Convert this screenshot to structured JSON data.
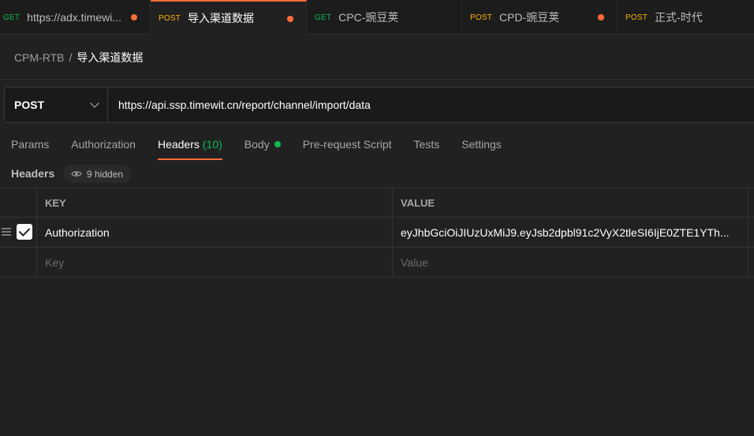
{
  "tabs": [
    {
      "method": "GET",
      "title": "https://adx.timewi..."
    },
    {
      "method": "POST",
      "title": "导入渠道数据"
    },
    {
      "method": "GET",
      "title": "CPC-豌豆荚"
    },
    {
      "method": "POST",
      "title": "CPD-豌豆荚"
    },
    {
      "method": "POST",
      "title": "正式-时代"
    }
  ],
  "breadcrumb": {
    "parent": "CPM-RTB",
    "separator": "/",
    "current": "导入渠道数据"
  },
  "request": {
    "method": "POST",
    "url": "https://api.ssp.timewit.cn/report/channel/import/data"
  },
  "request_tabs": {
    "params": "Params",
    "authorization": "Authorization",
    "headers": "Headers",
    "headers_count": "(10)",
    "body": "Body",
    "prerequest": "Pre-request Script",
    "tests": "Tests",
    "settings": "Settings"
  },
  "headers_section": {
    "label": "Headers",
    "hidden": "9 hidden"
  },
  "table": {
    "key_header": "KEY",
    "value_header": "VALUE",
    "rows": [
      {
        "key": "Authorization",
        "value": "eyJhbGciOiJIUzUxMiJ9.eyJsb2dpbl91c2VyX2tleSI6IjE0ZTE1YTh..."
      }
    ],
    "key_placeholder": "Key",
    "value_placeholder": "Value"
  },
  "colors": {
    "accent": "#ff6c37",
    "get": "#0cbb52",
    "post": "#ffb400",
    "background": "#212121"
  }
}
